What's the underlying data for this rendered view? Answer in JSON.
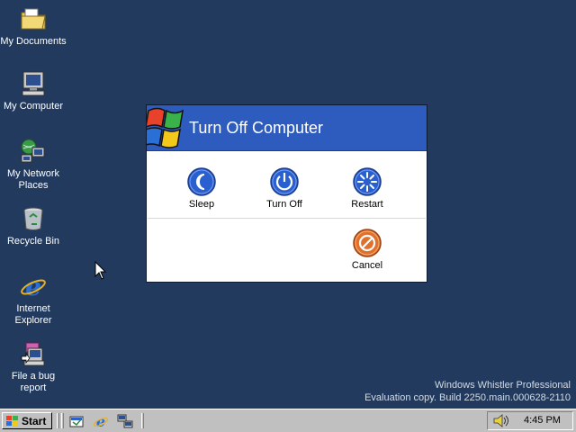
{
  "desktop": {
    "icons": [
      {
        "label": "My Documents"
      },
      {
        "label": "My Computer"
      },
      {
        "label": "My Network Places"
      },
      {
        "label": "Recycle Bin"
      },
      {
        "label": "Internet Explorer"
      },
      {
        "label": "File a bug report"
      }
    ],
    "watermark": {
      "line1": "Windows Whistler Professional",
      "line2": "Evaluation copy. Build 2250.main.000628-2110"
    }
  },
  "dialog": {
    "title": "Turn Off Computer",
    "buttons": {
      "sleep": "Sleep",
      "turn_off": "Turn Off",
      "restart": "Restart",
      "cancel": "Cancel"
    }
  },
  "taskbar": {
    "start_label": "Start",
    "clock": "4:45 PM"
  },
  "colors": {
    "desktop_bg": "#213a5d",
    "dialog_header": "#2d5cbe",
    "action_blue": "#2a5fd0",
    "cancel_orange": "#e0702a"
  }
}
